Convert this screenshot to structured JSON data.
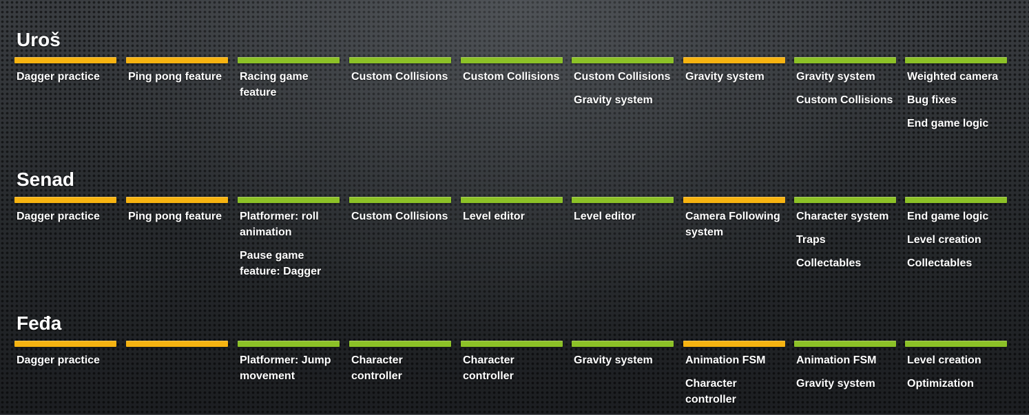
{
  "colors": {
    "orange": "#f6b311",
    "green": "#8cc127"
  },
  "rows": [
    {
      "name": "Uroš",
      "columns": [
        {
          "color": "orange",
          "items": [
            "Dagger practice"
          ]
        },
        {
          "color": "orange",
          "items": [
            "Ping pong feature"
          ]
        },
        {
          "color": "green",
          "items": [
            "Racing game feature"
          ]
        },
        {
          "color": "green",
          "items": [
            "Custom Collisions"
          ]
        },
        {
          "color": "green",
          "items": [
            "Custom Collisions"
          ]
        },
        {
          "color": "green",
          "items": [
            "Custom Collisions",
            "Gravity system"
          ]
        },
        {
          "color": "orange",
          "items": [
            "Gravity system"
          ]
        },
        {
          "color": "green",
          "items": [
            "Gravity system",
            "Custom Collisions"
          ]
        },
        {
          "color": "green",
          "items": [
            "Weighted camera",
            "Bug fixes",
            "End game logic"
          ]
        }
      ]
    },
    {
      "name": "Senad",
      "columns": [
        {
          "color": "orange",
          "items": [
            "Dagger practice"
          ]
        },
        {
          "color": "orange",
          "items": [
            "Ping pong feature"
          ]
        },
        {
          "color": "green",
          "items": [
            "Platformer: roll animation",
            "Pause game feature: Dagger"
          ]
        },
        {
          "color": "green",
          "items": [
            "Custom Collisions"
          ]
        },
        {
          "color": "green",
          "items": [
            "Level editor"
          ]
        },
        {
          "color": "green",
          "items": [
            "Level editor"
          ]
        },
        {
          "color": "orange",
          "items": [
            "Camera Following system"
          ]
        },
        {
          "color": "green",
          "items": [
            "Character system",
            "Traps",
            "Collectables"
          ]
        },
        {
          "color": "green",
          "items": [
            "End game logic",
            "Level creation",
            "Collectables"
          ]
        }
      ]
    },
    {
      "name": "Feđa",
      "columns": [
        {
          "color": "orange",
          "items": [
            "Dagger practice"
          ]
        },
        {
          "color": "orange",
          "items": []
        },
        {
          "color": "green",
          "items": [
            "Platformer: Jump movement"
          ]
        },
        {
          "color": "green",
          "items": [
            "Character controller"
          ]
        },
        {
          "color": "green",
          "items": [
            "Character controller"
          ]
        },
        {
          "color": "green",
          "items": [
            "Gravity system"
          ]
        },
        {
          "color": "orange",
          "items": [
            "Animation FSM",
            "Character controller"
          ]
        },
        {
          "color": "green",
          "items": [
            "Animation FSM",
            "Gravity system"
          ]
        },
        {
          "color": "green",
          "items": [
            "Level creation",
            "Optimization"
          ]
        }
      ]
    }
  ]
}
